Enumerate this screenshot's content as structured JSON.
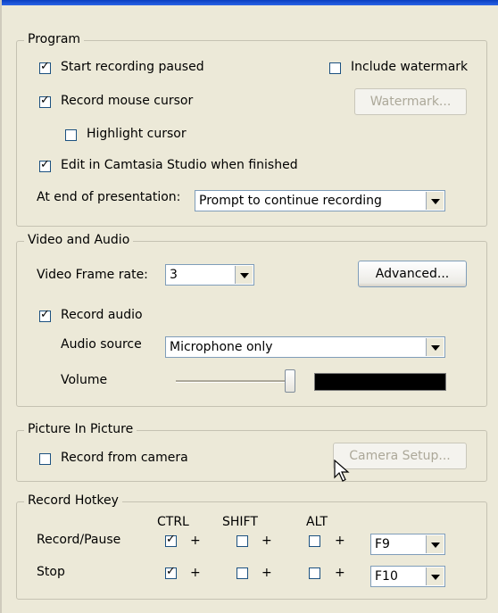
{
  "program": {
    "title": "Program",
    "start_paused": "Start recording paused",
    "include_watermark": "Include watermark",
    "record_cursor": "Record mouse cursor",
    "watermark_button": "Watermark...",
    "highlight_cursor": "Highlight cursor",
    "edit_in_studio": "Edit in Camtasia Studio when finished",
    "end_label": "At end of presentation:",
    "end_value": "Prompt to continue recording"
  },
  "video_audio": {
    "title": "Video and Audio",
    "frame_rate_label": "Video Frame rate:",
    "frame_rate_value": "3",
    "advanced_button": "Advanced...",
    "record_audio": "Record audio",
    "source_label": "Audio source",
    "source_value": "Microphone only",
    "volume_label": "Volume",
    "volume_level": 0.97
  },
  "pip": {
    "title": "Picture In Picture",
    "record_camera": "Record from camera",
    "camera_setup_button": "Camera Setup..."
  },
  "hotkey": {
    "title": "Record Hotkey",
    "ctrl": "CTRL",
    "shift": "SHIFT",
    "alt": "ALT",
    "plus": "+",
    "rows": [
      {
        "label": "Record/Pause",
        "ctrl": true,
        "shift": false,
        "alt": false,
        "key": "F9"
      },
      {
        "label": "Stop",
        "ctrl": true,
        "shift": false,
        "alt": false,
        "key": "F10"
      }
    ]
  }
}
